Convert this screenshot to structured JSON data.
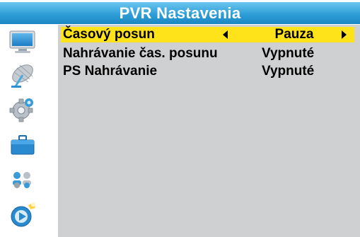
{
  "title": "PVR Nastavenia",
  "sidebar": {
    "icons": [
      {
        "name": "tv-icon"
      },
      {
        "name": "satellite-dish-icon"
      },
      {
        "name": "settings-gear-icon"
      },
      {
        "name": "toolbox-icon"
      },
      {
        "name": "users-icon"
      },
      {
        "name": "media-play-icon"
      }
    ]
  },
  "menu": {
    "items": [
      {
        "label": "Časový posun",
        "value": "Pauza"
      },
      {
        "label": "Nahrávanie čas. posunu",
        "value": "Vypnuté"
      },
      {
        "label": "PS Nahrávanie",
        "value": "Vypnuté"
      }
    ]
  },
  "colors": {
    "title_bar": "#2f9fd8",
    "highlight": "#ffe31a",
    "content_bg": "#cfd0d2"
  }
}
